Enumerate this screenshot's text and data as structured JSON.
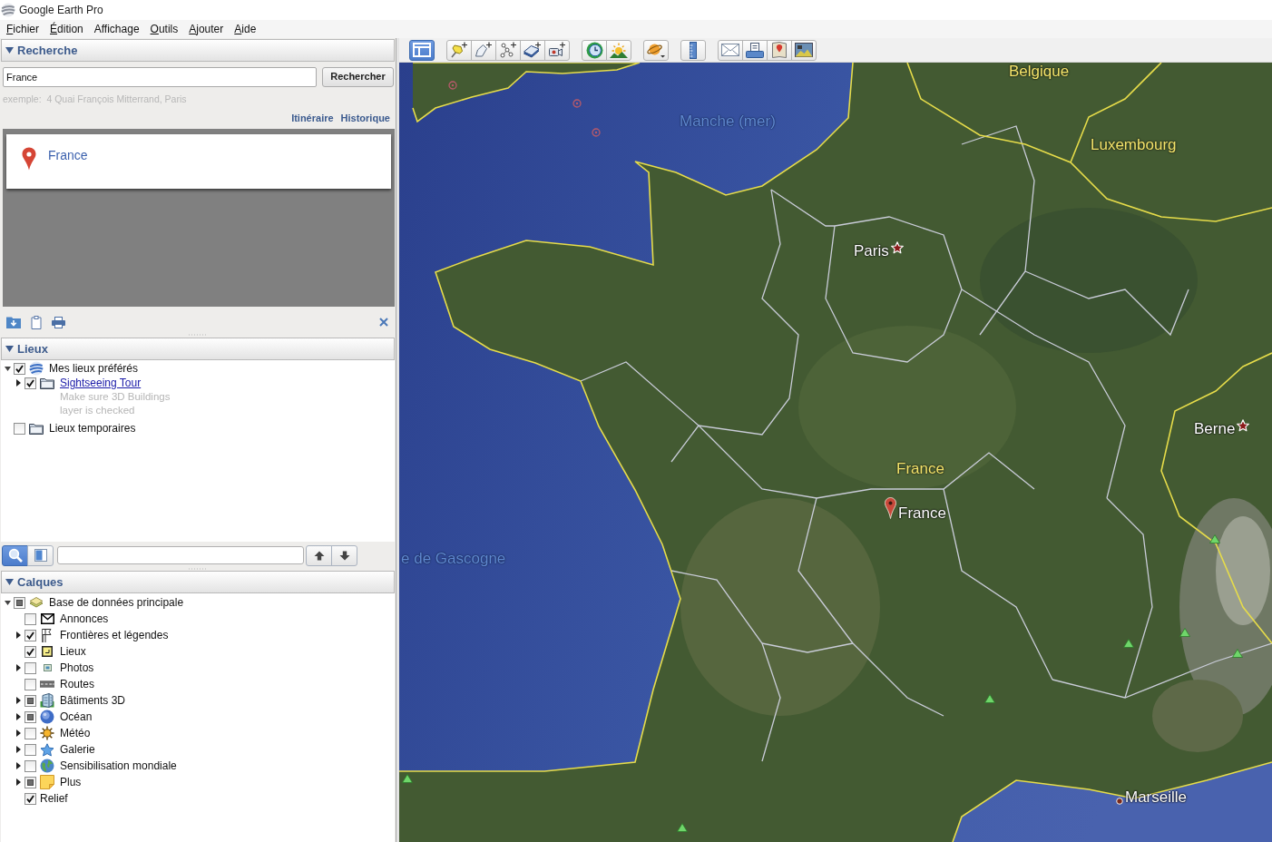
{
  "window": {
    "title": "Google Earth Pro"
  },
  "menu": [
    {
      "label": "Fichier",
      "mnemonic": true
    },
    {
      "label": "Édition",
      "mnemonic": true
    },
    {
      "label": "Affichage",
      "mnemonic": false
    },
    {
      "label": "Outils",
      "mnemonic": true
    },
    {
      "label": "Ajouter",
      "mnemonic": true
    },
    {
      "label": "Aide",
      "mnemonic": true
    }
  ],
  "search": {
    "title": "Recherche",
    "expanded": true,
    "query": "France",
    "button": "Rechercher",
    "hint": "exemple:  4 Quai François Mitterrand, Paris",
    "links": [
      "Itinéraire",
      "Historique"
    ],
    "results": [
      "France"
    ]
  },
  "places": {
    "title": "Lieux",
    "expanded": true,
    "items": [
      {
        "label": "Mes lieux préférés",
        "kind": "swirl",
        "checked": true,
        "mixed": false,
        "link": false,
        "expanded": true,
        "children": [
          {
            "label": "Sightseeing Tour",
            "kind": "folder",
            "checked": true,
            "mixed": false,
            "link": true,
            "expanded": false,
            "description": "Make sure 3D Buildings layer is checked"
          }
        ]
      },
      {
        "label": "Lieux temporaires",
        "kind": "folder",
        "checked": false,
        "mixed": false,
        "link": false
      }
    ]
  },
  "layer_search": {
    "search_toggle": {
      "pressed": true
    },
    "panel_toggle": {
      "pressed": false
    }
  },
  "layers": {
    "title": "Calques",
    "expanded": true,
    "items": [
      {
        "label": "Base de données principale",
        "kind": "layers",
        "checked": false,
        "mixed": true,
        "expanded": true,
        "children": [
          {
            "label": "Annonces",
            "kind": "envelope",
            "checked": false,
            "mixed": false
          },
          {
            "label": "Frontières et légendes",
            "kind": "flags",
            "checked": true,
            "mixed": false,
            "expanded": false
          },
          {
            "label": "Lieux",
            "kind": "square",
            "checked": true,
            "mixed": false
          },
          {
            "label": "Photos",
            "kind": "picture",
            "checked": false,
            "mixed": false,
            "expanded": false
          },
          {
            "label": "Routes",
            "kind": "road",
            "checked": false,
            "mixed": false
          },
          {
            "label": "Bâtiments 3D",
            "kind": "building",
            "checked": false,
            "mixed": true,
            "expanded": false
          },
          {
            "label": "Océan",
            "kind": "sphere",
            "checked": false,
            "mixed": true,
            "expanded": false
          },
          {
            "label": "Météo",
            "kind": "sun",
            "checked": false,
            "mixed": false,
            "expanded": false
          },
          {
            "label": "Galerie",
            "kind": "star",
            "checked": false,
            "mixed": false,
            "expanded": false
          },
          {
            "label": "Sensibilisation mondiale",
            "kind": "earth",
            "checked": false,
            "mixed": false,
            "expanded": false
          },
          {
            "label": "Plus",
            "kind": "note",
            "checked": false,
            "mixed": true,
            "expanded": false
          },
          {
            "label": "Relief",
            "kind": "plain",
            "checked": true,
            "mixed": false
          }
        ]
      }
    ]
  },
  "map_toolbar": {
    "sidebar_toggle": {
      "pressed": true
    }
  },
  "map": {
    "labels": [
      {
        "text": "Belgique",
        "kind": "country"
      },
      {
        "text": "Manche (mer)",
        "kind": "sea"
      },
      {
        "text": "Luxembourg",
        "kind": "country"
      },
      {
        "text": "Paris",
        "kind": "capital"
      },
      {
        "text": "Berne",
        "kind": "capital"
      },
      {
        "text": "France",
        "kind": "country"
      },
      {
        "text": "France",
        "kind": "result"
      },
      {
        "text": "e de Gascogne",
        "kind": "sea"
      },
      {
        "text": "Marseille",
        "kind": "city"
      }
    ]
  }
}
